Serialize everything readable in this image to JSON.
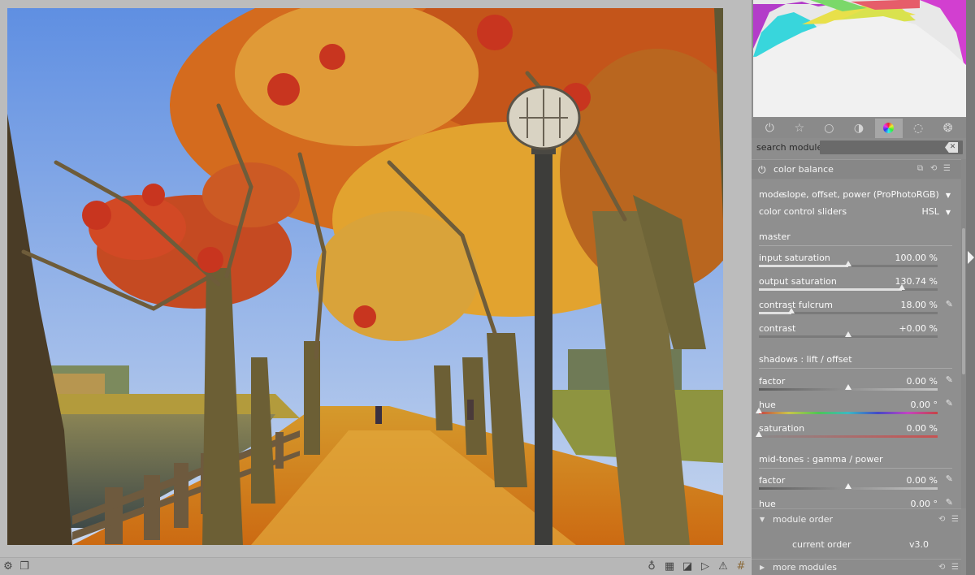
{
  "search": {
    "label": "search module",
    "value": ""
  },
  "module_groups": [
    "power-icon",
    "star-icon",
    "circle-icon",
    "tone-icon",
    "color-icon",
    "correct-icon",
    "effect-icon"
  ],
  "module": {
    "title": "color balance",
    "mode_label": "mode",
    "mode_value": "slope, offset, power (ProPhotoRGB)",
    "sliders_label": "color control sliders",
    "sliders_value": "HSL",
    "master_title": "master",
    "input_saturation": {
      "label": "input saturation",
      "value": "100.00 %",
      "level": 0.5
    },
    "output_saturation": {
      "label": "output saturation",
      "value": "130.74 %",
      "level": 0.8
    },
    "contrast_fulcrum": {
      "label": "contrast fulcrum",
      "value": "18.00 %",
      "level": 0.18
    },
    "contrast": {
      "label": "contrast",
      "value": "+0.00 %",
      "level": 0.5
    },
    "shadows_title": "shadows : lift / offset",
    "shadows_factor": {
      "label": "factor",
      "value": "0.00 %",
      "level": 0.5
    },
    "shadows_hue": {
      "label": "hue",
      "value": "0.00 °",
      "level": 0.0
    },
    "shadows_saturation": {
      "label": "saturation",
      "value": "0.00 %",
      "level": 0.0
    },
    "midtones_title": "mid-tones : gamma / power",
    "midtones_factor": {
      "label": "factor",
      "value": "0.00 %",
      "level": 0.5
    },
    "midtones_hue": {
      "label": "hue",
      "value": "0.00 °",
      "level": 0.0
    }
  },
  "module_order": {
    "title": "module order",
    "current_label": "current order",
    "current_value": "v3.0"
  },
  "more_modules": {
    "title": "more modules"
  }
}
